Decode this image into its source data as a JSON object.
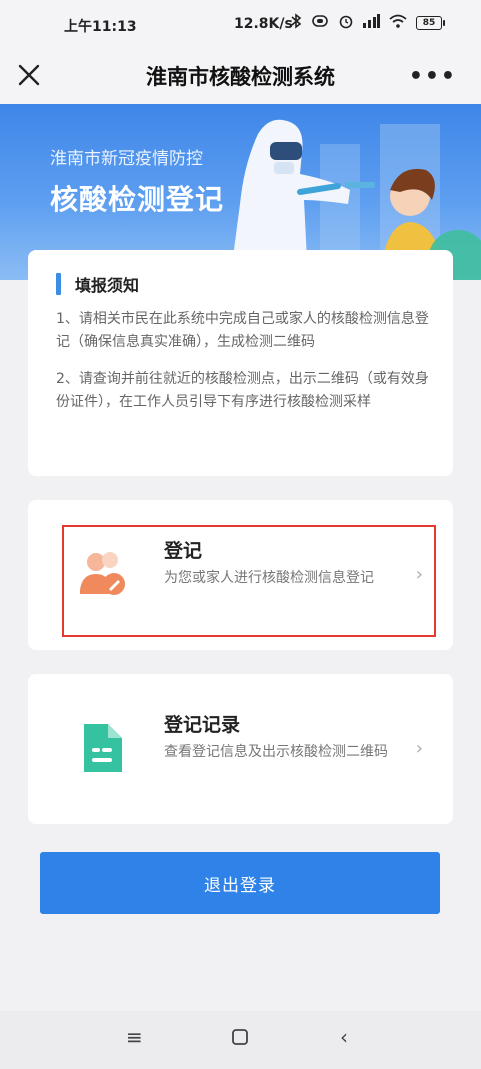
{
  "status_bar": {
    "time": "上午11:13",
    "network_speed": "12.8K/s",
    "battery": "85"
  },
  "title_bar": {
    "title": "淮南市核酸检测系统",
    "close_icon": "close-icon",
    "more_icon": "more-icon"
  },
  "banner": {
    "subtitle": "淮南市新冠疫情防控",
    "title": "核酸检测登记"
  },
  "notice": {
    "heading": "填报须知",
    "items": [
      "1、请相关市民在此系统中完成自己或家人的核酸检测信息登记（确保信息真实准确），生成检测二维码",
      "2、请查询并前往就近的核酸检测点，出示二维码（或有效身份证件），在工作人员引导下有序进行核酸检测采样"
    ]
  },
  "menu": [
    {
      "label": "登记",
      "description": "为您或家人进行核酸检测信息登记",
      "icon": "user-edit-icon"
    },
    {
      "label": "登记记录",
      "description": "查看登记信息及出示核酸检测二维码",
      "icon": "document-icon"
    }
  ],
  "logout_button": "退出登录",
  "colors": {
    "accent_blue": "#2f83e8",
    "highlight_red": "#e53a2f",
    "orange_icon": "#f08a5d",
    "green_icon": "#35c2a0"
  }
}
